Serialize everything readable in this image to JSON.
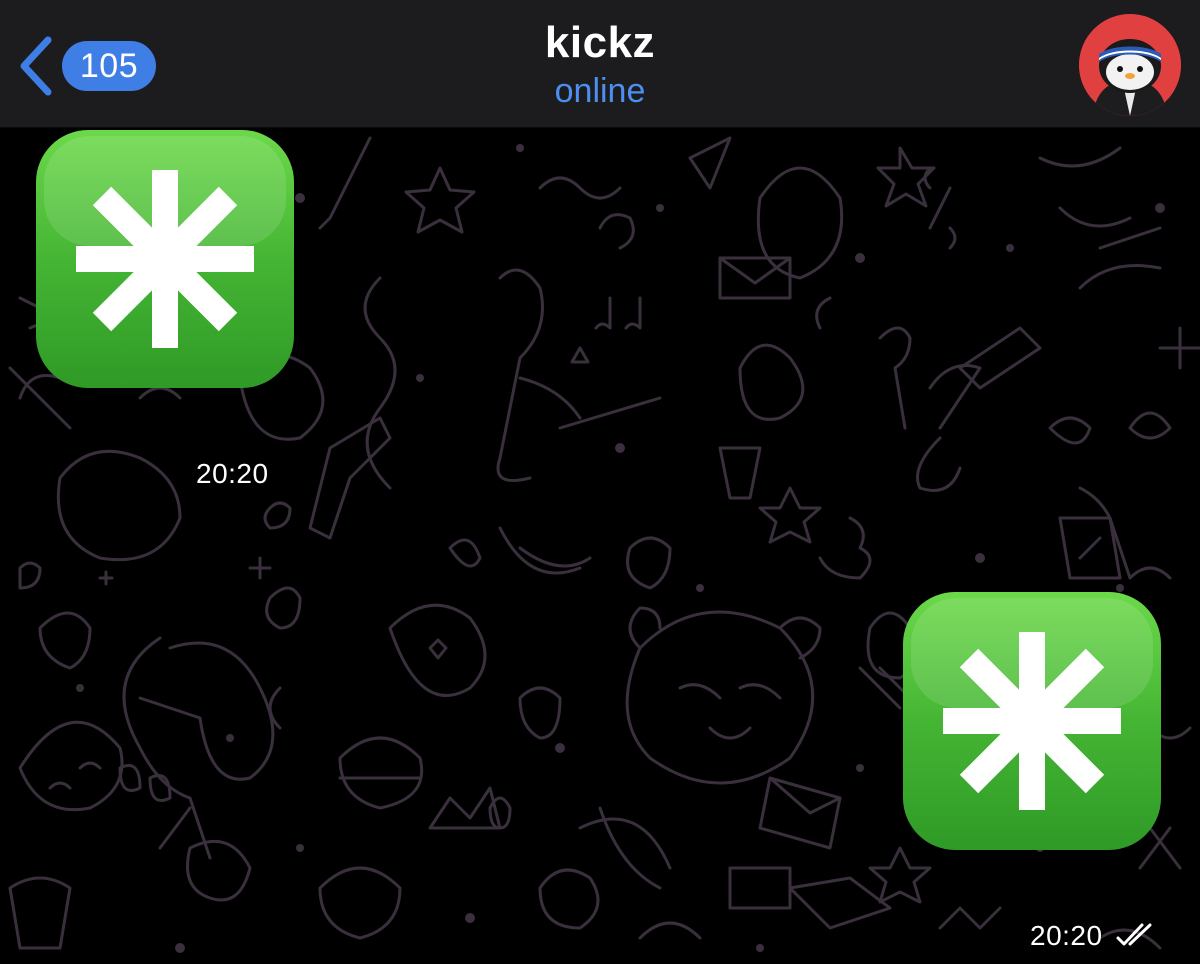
{
  "header": {
    "back_label": "",
    "unread_count": "105",
    "title": "kickz",
    "status": "online",
    "avatar_icon": "penguin-avatar-icon"
  },
  "colors": {
    "header_bg": "#1c1b1d",
    "accent": "#3e7ee5",
    "status": "#4d8ff0",
    "emoji_green": "#3fae2e",
    "pattern_line": "#3a2f3c"
  },
  "messages": [
    {
      "direction": "incoming",
      "emoji": "eight-spoked-asterisk",
      "time": "20:20"
    },
    {
      "direction": "outgoing",
      "emoji": "eight-spoked-asterisk",
      "time": "20:20",
      "read": true
    }
  ]
}
